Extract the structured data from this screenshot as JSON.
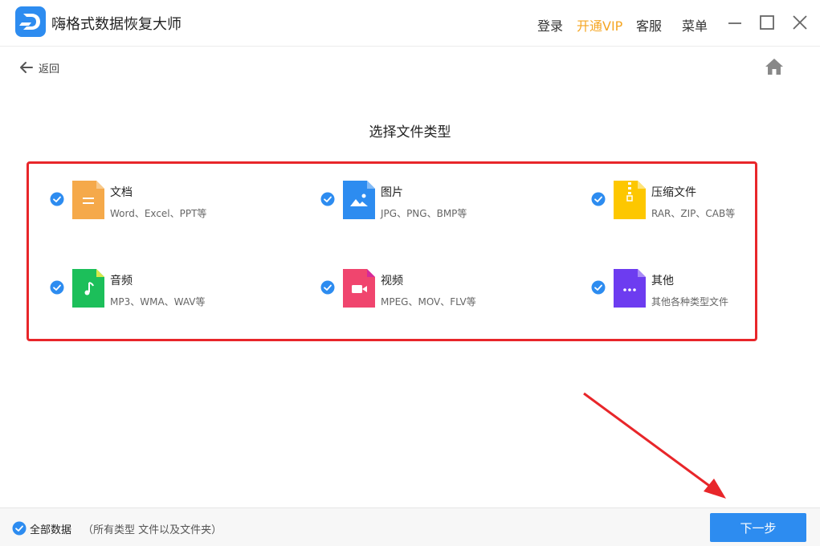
{
  "app": {
    "title": "嗨格式数据恢复大师"
  },
  "topbar": {
    "login": "登录",
    "vip": "开通VIP",
    "service": "客服",
    "menu": "菜单"
  },
  "nav": {
    "back_label": "返回"
  },
  "main": {
    "title": "选择文件类型",
    "types": [
      {
        "name": "文档",
        "desc": "Word、Excel、PPT等",
        "checked": true,
        "color": "#f5a94a",
        "icon": "document-icon"
      },
      {
        "name": "图片",
        "desc": "JPG、PNG、BMP等",
        "checked": true,
        "color": "#2d8cf0",
        "icon": "image-icon"
      },
      {
        "name": "压缩文件",
        "desc": "RAR、ZIP、CAB等",
        "checked": true,
        "color": "#fdc700",
        "icon": "archive-icon"
      },
      {
        "name": "音频",
        "desc": "MP3、WMA、WAV等",
        "checked": true,
        "color": "#1cbf5a",
        "icon": "audio-icon"
      },
      {
        "name": "视频",
        "desc": "MPEG、MOV、FLV等",
        "checked": true,
        "color": "#f0456e",
        "icon": "video-icon"
      },
      {
        "name": "其他",
        "desc": "其他各种类型文件",
        "checked": true,
        "color": "#6d3cf0",
        "icon": "other-icon"
      }
    ]
  },
  "footer": {
    "all_label": "全部数据",
    "all_desc": "（所有类型 文件以及文件夹）",
    "all_checked": true,
    "next_label": "下一步"
  },
  "colors": {
    "accent": "#2d8cf0",
    "vip": "#f5a623",
    "highlight": "#e8262a"
  }
}
